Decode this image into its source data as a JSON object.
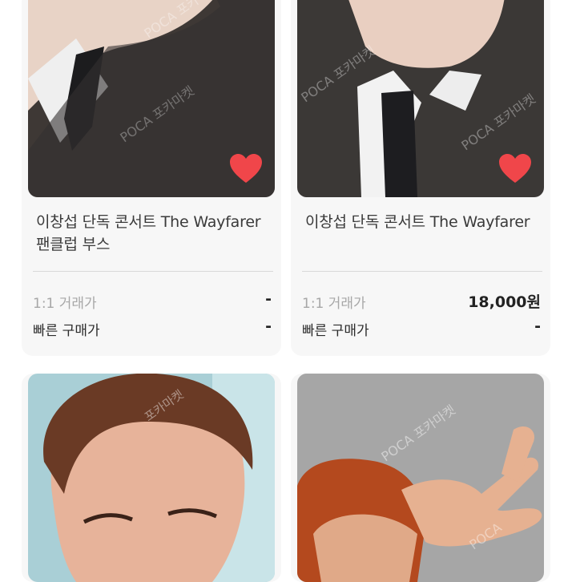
{
  "products": [
    {
      "title": "이창섭 단독 콘서트 The Wayfarer 팬클럽 부스",
      "row1_label": "1:1 거래가",
      "row1_value": "-",
      "row2_label": "빠른 구매가",
      "row2_value": "-",
      "liked": true
    },
    {
      "title": "이창섭 단독 콘서트 The Wayfarer",
      "row1_label": "1:1 거래가",
      "row1_value": "18,000원",
      "row2_label": "빠른 구매가",
      "row2_value": "-",
      "liked": true
    }
  ],
  "colors": {
    "heart": "#f0464a",
    "card_bg": "#f7f7f7",
    "divider": "#d9d9d9"
  },
  "icons": {
    "like": "heart-icon"
  }
}
